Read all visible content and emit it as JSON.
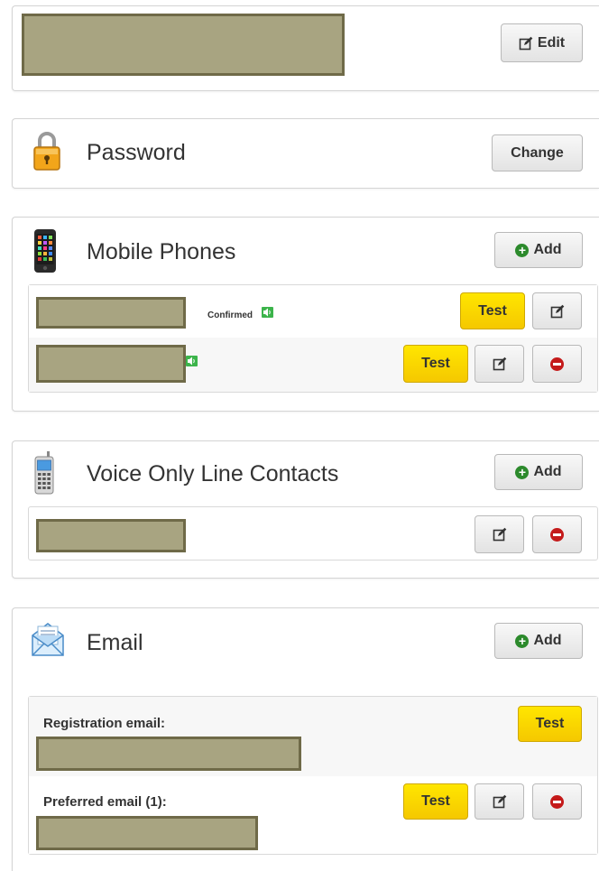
{
  "profile": {
    "edit_label": "Edit"
  },
  "password": {
    "title": "Password",
    "change_label": "Change"
  },
  "mobile": {
    "title": "Mobile Phones",
    "add_label": "Add",
    "rows": [
      {
        "status": "Confirmed",
        "test_label": "Test"
      },
      {
        "test_label": "Test"
      }
    ]
  },
  "voice": {
    "title": "Voice Only Line Contacts",
    "add_label": "Add"
  },
  "email": {
    "title": "Email",
    "add_label": "Add",
    "registration_label": "Registration email:",
    "registration_test": "Test",
    "preferred_label": "Preferred email (1):",
    "preferred_test": "Test"
  },
  "colors": {
    "test_button": "#f5c800",
    "add_icon": "#2c8a2c",
    "remove_icon": "#c41a1a",
    "redaction": "#a8a481"
  },
  "icons": [
    "edit-icon",
    "lock-icon",
    "mobile-phone-icon",
    "voice-phone-icon",
    "envelope-icon",
    "plus-icon",
    "remove-icon",
    "sound-icon"
  ]
}
